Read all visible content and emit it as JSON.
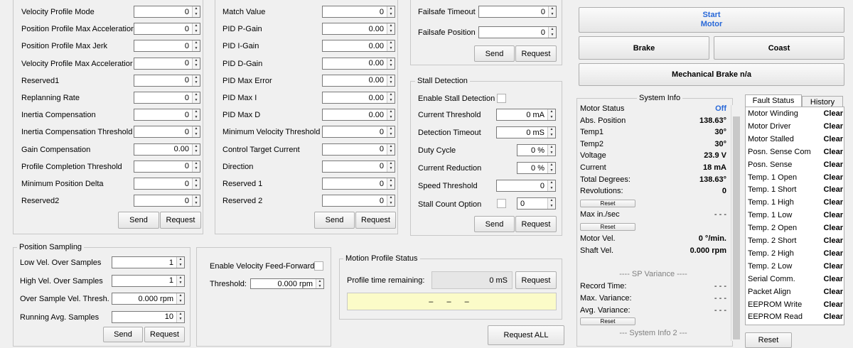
{
  "profile_panel": {
    "rows": [
      {
        "label": "Velocity Profile Mode",
        "value": "0"
      },
      {
        "label": "Position Profile Max Acceleratior",
        "value": "0"
      },
      {
        "label": "Position Profile Max Jerk",
        "value": "0"
      },
      {
        "label": "Velocity Profile Max Acceleratior",
        "value": "0"
      },
      {
        "label": "Reserved1",
        "value": "0"
      },
      {
        "label": "Replanning Rate",
        "value": "0"
      },
      {
        "label": "Inertia Compensation",
        "value": "0"
      },
      {
        "label": "Inertia Compensation Threshold",
        "value": "0"
      },
      {
        "label": "Gain Compensation",
        "value": "0.00"
      },
      {
        "label": "Profile Completion Threshold",
        "value": "0"
      },
      {
        "label": "Minimum Position Delta",
        "value": "0"
      },
      {
        "label": "Reserved2",
        "value": "0"
      }
    ],
    "send": "Send",
    "request": "Request"
  },
  "pid_panel": {
    "rows": [
      {
        "label": "Match Value",
        "value": "0"
      },
      {
        "label": "PID  P-Gain",
        "value": "0.00"
      },
      {
        "label": "PID  I-Gain",
        "value": "0.00"
      },
      {
        "label": "PID  D-Gain",
        "value": "0.00"
      },
      {
        "label": "PID Max Error",
        "value": "0.00"
      },
      {
        "label": "PID Max I",
        "value": "0.00"
      },
      {
        "label": "PID Max D",
        "value": "0.00"
      },
      {
        "label": "Minimum Velocity Threshold",
        "value": "0"
      },
      {
        "label": "Control Target Current",
        "value": "0"
      },
      {
        "label": "Direction",
        "value": "0"
      },
      {
        "label": "Reserved 1",
        "value": "0"
      },
      {
        "label": "Reserved 2",
        "value": "0"
      }
    ],
    "send": "Send",
    "request": "Request"
  },
  "failsafe": {
    "timeout_label": "Failsafe Timeout",
    "timeout_value": "0",
    "position_label": "Failsafe Position",
    "position_value": "0",
    "send": "Send",
    "request": "Request"
  },
  "stall": {
    "title": "Stall Detection",
    "enable_label": "Enable Stall Detection",
    "current_threshold_label": "Current Threshold",
    "current_threshold_value": "0 mA",
    "detection_timeout_label": "Detection Timeout",
    "detection_timeout_value": "0 mS",
    "duty_cycle_label": "Duty Cycle",
    "duty_cycle_value": "0 %",
    "current_reduction_label": "Current Reduction",
    "current_reduction_value": "0 %",
    "speed_threshold_label": "Speed Threshold",
    "speed_threshold_value": "0",
    "stall_count_label": "Stall Count Option",
    "stall_count_value": "0",
    "send": "Send",
    "request": "Request"
  },
  "position_sampling": {
    "title": "Position Sampling",
    "rows": [
      {
        "label": "Low Vel. Over Samples",
        "value": "1"
      },
      {
        "label": "High Vel. Over Samples",
        "value": "1"
      },
      {
        "label": "Over Sample Vel. Thresh.",
        "value": "0.000 rpm"
      },
      {
        "label": "Running Avg. Samples",
        "value": "10"
      }
    ],
    "send": "Send",
    "request": "Request"
  },
  "velocity_ff": {
    "enable_label": "Enable Velocity Feed-Forward",
    "threshold_label": "Threshold:",
    "threshold_value": "0.000 rpm"
  },
  "motion_profile": {
    "title": "Motion Profile Status",
    "remaining_label": "Profile time remaining:",
    "remaining_value": "0 mS",
    "request": "Request",
    "status_text": "– – –"
  },
  "request_all": "Request ALL",
  "motor_buttons": {
    "start_line1": "Start",
    "start_line2": "Motor",
    "brake": "Brake",
    "coast": "Coast",
    "mech_brake": "Mechanical Brake n/a",
    "start_color": "#2868d8"
  },
  "system_info": {
    "title": "System Info",
    "rows": [
      {
        "key": "Motor Status",
        "value": "Off"
      },
      {
        "key": "Abs. Position",
        "value": "138.63°"
      },
      {
        "key": "Temp1",
        "value": "30°"
      },
      {
        "key": "Temp2",
        "value": "30°"
      },
      {
        "key": "Voltage",
        "value": "23.9 V"
      },
      {
        "key": "Current",
        "value": "18 mA"
      },
      {
        "key": "Total Degrees:",
        "value": "138.63°"
      },
      {
        "key": "Revolutions:",
        "value": "0"
      }
    ],
    "reset": "Reset",
    "max_in_sec_label": "Max in./sec",
    "max_in_sec_value": "- - -",
    "motor_vel_label": "Motor Vel.",
    "motor_vel_value": "0 °/min.",
    "shaft_vel_label": "Shaft Vel.",
    "shaft_vel_value": "0.000 rpm",
    "sp_variance_title": "---- SP Variance ----",
    "record_time_label": "Record Time:",
    "record_time_value": "- - -",
    "max_variance_label": "Max. Variance:",
    "max_variance_value": "- - -",
    "avg_variance_label": "Avg. Variance:",
    "avg_variance_value": "- - -",
    "info2_title": "--- System Info 2 ---"
  },
  "fault_status": {
    "tab_active": "Fault Status",
    "tab_history": "History",
    "rows": [
      {
        "key": "Motor Winding",
        "value": "Clear"
      },
      {
        "key": "Motor Driver",
        "value": "Clear"
      },
      {
        "key": "Motor Stalled",
        "value": "Clear"
      },
      {
        "key": "Posn. Sense Com",
        "value": "Clear"
      },
      {
        "key": "Posn. Sense",
        "value": "Clear"
      },
      {
        "key": "Temp. 1 Open",
        "value": "Clear"
      },
      {
        "key": "Temp. 1 Short",
        "value": "Clear"
      },
      {
        "key": "Temp. 1 High",
        "value": "Clear"
      },
      {
        "key": "Temp. 1 Low",
        "value": "Clear"
      },
      {
        "key": "Temp. 2 Open",
        "value": "Clear"
      },
      {
        "key": "Temp. 2 Short",
        "value": "Clear"
      },
      {
        "key": "Temp. 2 High",
        "value": "Clear"
      },
      {
        "key": "Temp. 2 Low",
        "value": "Clear"
      },
      {
        "key": "Serial Comm.",
        "value": "Clear"
      },
      {
        "key": "Packet Align",
        "value": "Clear"
      },
      {
        "key": "EEPROM Write",
        "value": "Clear"
      },
      {
        "key": "EEPROM Read",
        "value": "Clear"
      }
    ],
    "reset": "Reset"
  }
}
